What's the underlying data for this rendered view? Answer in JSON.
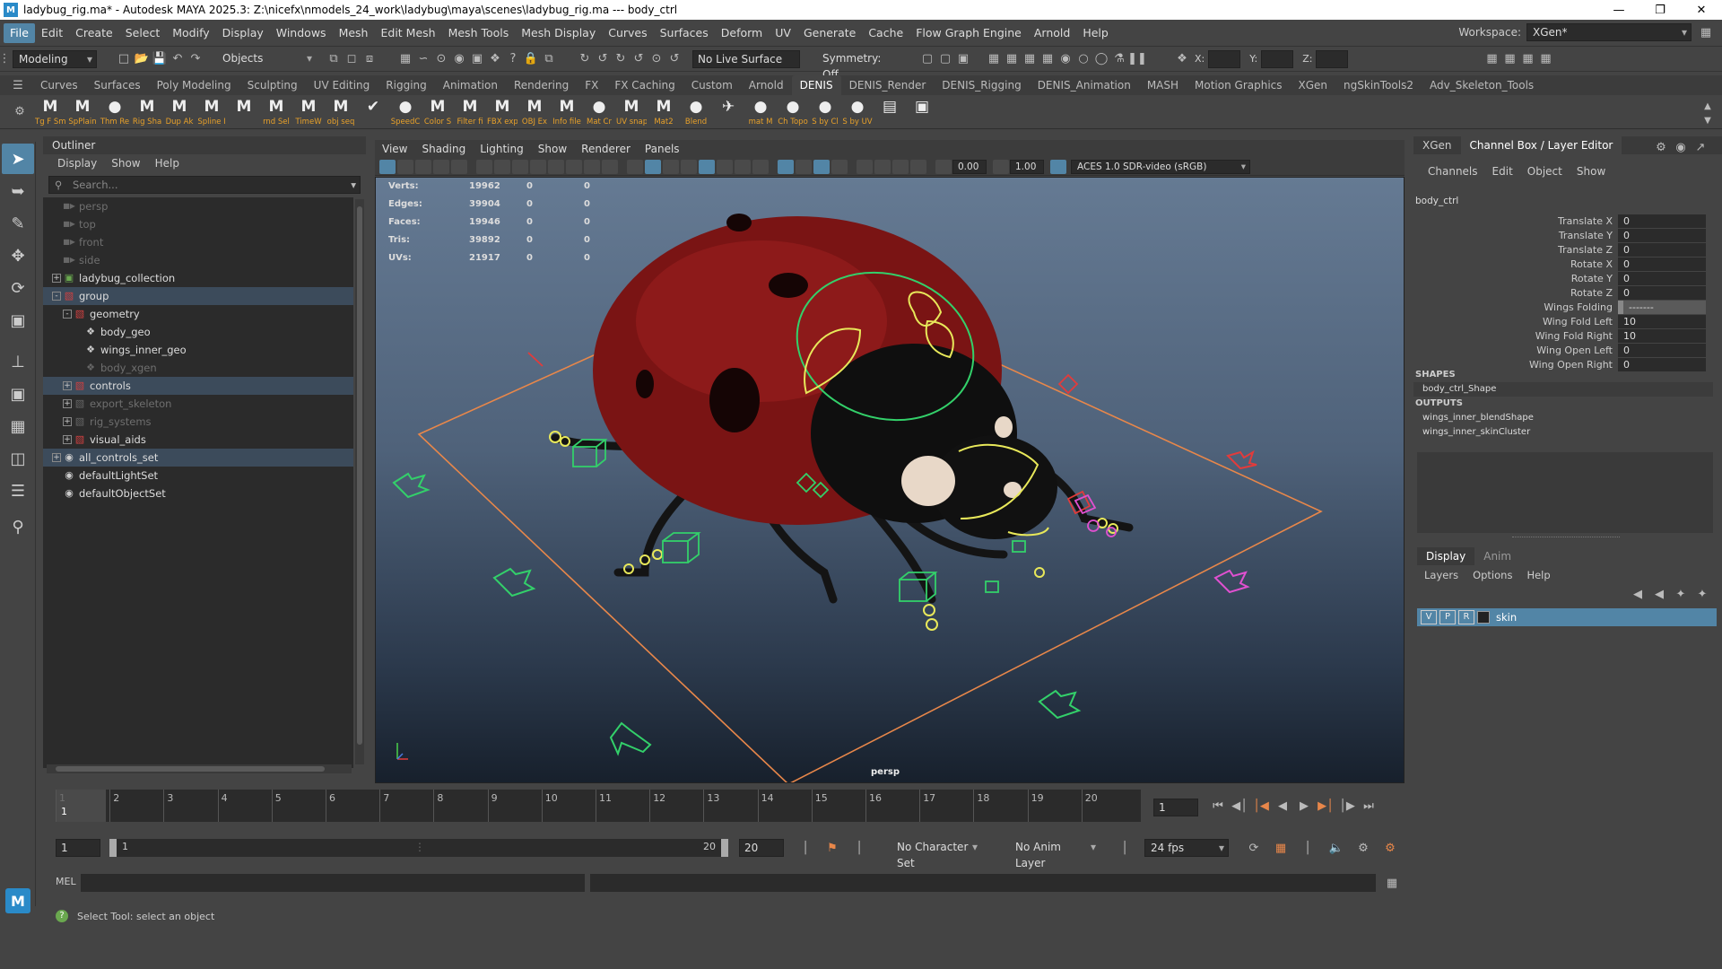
{
  "title": "ladybug_rig.ma* - Autodesk MAYA 2025.3: Z:\\nicefx\\nmodels_24_work\\ladybug\\maya\\scenes\\ladybug_rig.ma   ---   body_ctrl",
  "menubar": [
    "File",
    "Edit",
    "Create",
    "Select",
    "Modify",
    "Display",
    "Windows",
    "Mesh",
    "Edit Mesh",
    "Mesh Tools",
    "Mesh Display",
    "Curves",
    "Surfaces",
    "Deform",
    "UV",
    "Generate",
    "Cache",
    "Flow Graph Engine",
    "Arnold",
    "Help"
  ],
  "workspace": {
    "label": "Workspace:",
    "value": "XGen*"
  },
  "status": {
    "mode": "Modeling",
    "objects": "Objects",
    "live_surface": "No Live Surface",
    "symmetry": "Symmetry: Off",
    "x_label": "X:",
    "y_label": "Y:",
    "z_label": "Z:"
  },
  "shelf_tabs": [
    "Curves",
    "Surfaces",
    "Poly Modeling",
    "Sculpting",
    "UV Editing",
    "Rigging",
    "Animation",
    "Rendering",
    "FX",
    "FX Caching",
    "Custom",
    "Arnold",
    "DENIS",
    "DENIS_Render",
    "DENIS_Rigging",
    "DENIS_Animation",
    "MASH",
    "Motion Graphics",
    "XGen",
    "ngSkinTools2",
    "Adv_Skeleton_Tools"
  ],
  "shelf_active": "DENIS",
  "shelf_items": [
    {
      "g": "M",
      "l": "Tg F Sm"
    },
    {
      "g": "M",
      "l": "SpPlain"
    },
    {
      "g": "●",
      "l": "Thm Re"
    },
    {
      "g": "M",
      "l": "Rig Sha"
    },
    {
      "g": "M",
      "l": "Dup Ak"
    },
    {
      "g": "M",
      "l": "Spline I"
    },
    {
      "g": "M",
      "l": ""
    },
    {
      "g": "M",
      "l": "rnd Sel"
    },
    {
      "g": "M",
      "l": "TimeW"
    },
    {
      "g": "M",
      "l": "obj seq"
    },
    {
      "g": "✔",
      "l": ""
    },
    {
      "g": "●",
      "l": "SpeedC"
    },
    {
      "g": "M",
      "l": "Color S"
    },
    {
      "g": "M",
      "l": "Filter fi"
    },
    {
      "g": "M",
      "l": "FBX exp"
    },
    {
      "g": "M",
      "l": "OBJ Ex"
    },
    {
      "g": "M",
      "l": "Info file"
    },
    {
      "g": "●",
      "l": "Mat Cr"
    },
    {
      "g": "M",
      "l": "UV snap"
    },
    {
      "g": "M",
      "l": "Mat2"
    },
    {
      "g": "●",
      "l": "Blend"
    },
    {
      "g": "✈",
      "l": ""
    },
    {
      "g": "●",
      "l": "mat M"
    },
    {
      "g": "●",
      "l": "Ch Topo"
    },
    {
      "g": "●",
      "l": "S by Cl"
    },
    {
      "g": "●",
      "l": "S by UV"
    },
    {
      "g": "▤",
      "l": ""
    },
    {
      "g": "▣",
      "l": ""
    }
  ],
  "outliner": {
    "title": "Outliner",
    "menu": [
      "Display",
      "Show",
      "Help"
    ],
    "search_placeholder": "Search...",
    "items": [
      {
        "label": "persp",
        "depth": 1,
        "type": "camera",
        "dim": true,
        "exp": ""
      },
      {
        "label": "top",
        "depth": 1,
        "type": "camera",
        "dim": true,
        "exp": ""
      },
      {
        "label": "front",
        "depth": 1,
        "type": "camera",
        "dim": true,
        "exp": ""
      },
      {
        "label": "side",
        "depth": 1,
        "type": "camera",
        "dim": true,
        "exp": ""
      },
      {
        "label": "ladybug_collection",
        "depth": 1,
        "type": "collection",
        "dim": false,
        "exp": "+"
      },
      {
        "label": "group",
        "depth": 1,
        "type": "group",
        "dim": false,
        "exp": "-",
        "hl": true
      },
      {
        "label": "geometry",
        "depth": 2,
        "type": "group",
        "dim": false,
        "exp": "-"
      },
      {
        "label": "body_geo",
        "depth": 3,
        "type": "mesh",
        "dim": false,
        "exp": ""
      },
      {
        "label": "wings_inner_geo",
        "depth": 3,
        "type": "mesh",
        "dim": false,
        "exp": ""
      },
      {
        "label": "body_xgen",
        "depth": 3,
        "type": "mesh",
        "dim": true,
        "exp": ""
      },
      {
        "label": "controls",
        "depth": 2,
        "type": "group",
        "dim": false,
        "exp": "+",
        "hl": true
      },
      {
        "label": "export_skeleton",
        "depth": 2,
        "type": "group",
        "dim": true,
        "exp": "+"
      },
      {
        "label": "rig_systems",
        "depth": 2,
        "type": "group",
        "dim": true,
        "exp": "+"
      },
      {
        "label": "visual_aids",
        "depth": 2,
        "type": "group",
        "dim": false,
        "exp": "+"
      },
      {
        "label": "all_controls_set",
        "depth": 1,
        "type": "set",
        "dim": false,
        "exp": "+",
        "hl": true
      },
      {
        "label": "defaultLightSet",
        "depth": 1,
        "type": "set",
        "dim": false,
        "exp": ""
      },
      {
        "label": "defaultObjectSet",
        "depth": 1,
        "type": "set",
        "dim": false,
        "exp": ""
      }
    ]
  },
  "viewport": {
    "menu": [
      "View",
      "Shading",
      "Lighting",
      "Show",
      "Renderer",
      "Panels"
    ],
    "exposure": "0.00",
    "gamma": "1.00",
    "colorspace": "ACES 1.0 SDR-video (sRGB)",
    "camera": "persp",
    "hud": [
      {
        "k": "Verts:",
        "a": "19962",
        "b": "0",
        "c": "0"
      },
      {
        "k": "Edges:",
        "a": "39904",
        "b": "0",
        "c": "0"
      },
      {
        "k": "Faces:",
        "a": "19946",
        "b": "0",
        "c": "0"
      },
      {
        "k": "Tris:",
        "a": "39892",
        "b": "0",
        "c": "0"
      },
      {
        "k": "UVs:",
        "a": "21917",
        "b": "0",
        "c": "0"
      }
    ]
  },
  "channelbox": {
    "tabs": [
      "XGen",
      "Channel Box / Layer Editor"
    ],
    "menu": [
      "Channels",
      "Edit",
      "Object",
      "Show"
    ],
    "object": "body_ctrl",
    "attrs": [
      {
        "n": "Translate X",
        "v": "0"
      },
      {
        "n": "Translate Y",
        "v": "0"
      },
      {
        "n": "Translate Z",
        "v": "0"
      },
      {
        "n": "Rotate X",
        "v": "0"
      },
      {
        "n": "Rotate Y",
        "v": "0"
      },
      {
        "n": "Rotate Z",
        "v": "0"
      },
      {
        "n": "Wings Folding",
        "v": "-------"
      },
      {
        "n": "Wing Fold Left",
        "v": "10"
      },
      {
        "n": "Wing Fold Right",
        "v": "10"
      },
      {
        "n": "Wing Open Left",
        "v": "0"
      },
      {
        "n": "Wing Open Right",
        "v": "0"
      }
    ],
    "shapes_header": "SHAPES",
    "shape": "body_ctrl_Shape",
    "outputs_header": "OUTPUTS",
    "outputs": [
      "wings_inner_blendShape",
      "wings_inner_skinCluster"
    ]
  },
  "layers": {
    "tabs": [
      "Display",
      "Anim"
    ],
    "menu": [
      "Layers",
      "Options",
      "Help"
    ],
    "rows": [
      {
        "v": "V",
        "p": "P",
        "r": "R",
        "name": "skin"
      }
    ]
  },
  "timeline": {
    "ticks": [
      "1",
      "2",
      "3",
      "4",
      "5",
      "6",
      "7",
      "8",
      "9",
      "10",
      "11",
      "12",
      "13",
      "14",
      "15",
      "16",
      "17",
      "18",
      "19",
      "20"
    ],
    "current": "1",
    "current_field": "1",
    "range_start": "1",
    "range_inner_start": "1",
    "range_inner_end": "20",
    "range_end": "20",
    "character_set": "No Character Set",
    "anim_layer": "No Anim Layer",
    "fps": "24 fps"
  },
  "cmdline": {
    "lang": "MEL"
  },
  "helpline": "Select Tool: select an object",
  "colors": {
    "accent": "#5285a6",
    "controls_yellow": "#e8e85a",
    "controls_green": "#33d06a",
    "controls_red": "#e23b3b",
    "controls_magenta": "#e050d0",
    "ground_orange": "#e8874a"
  }
}
